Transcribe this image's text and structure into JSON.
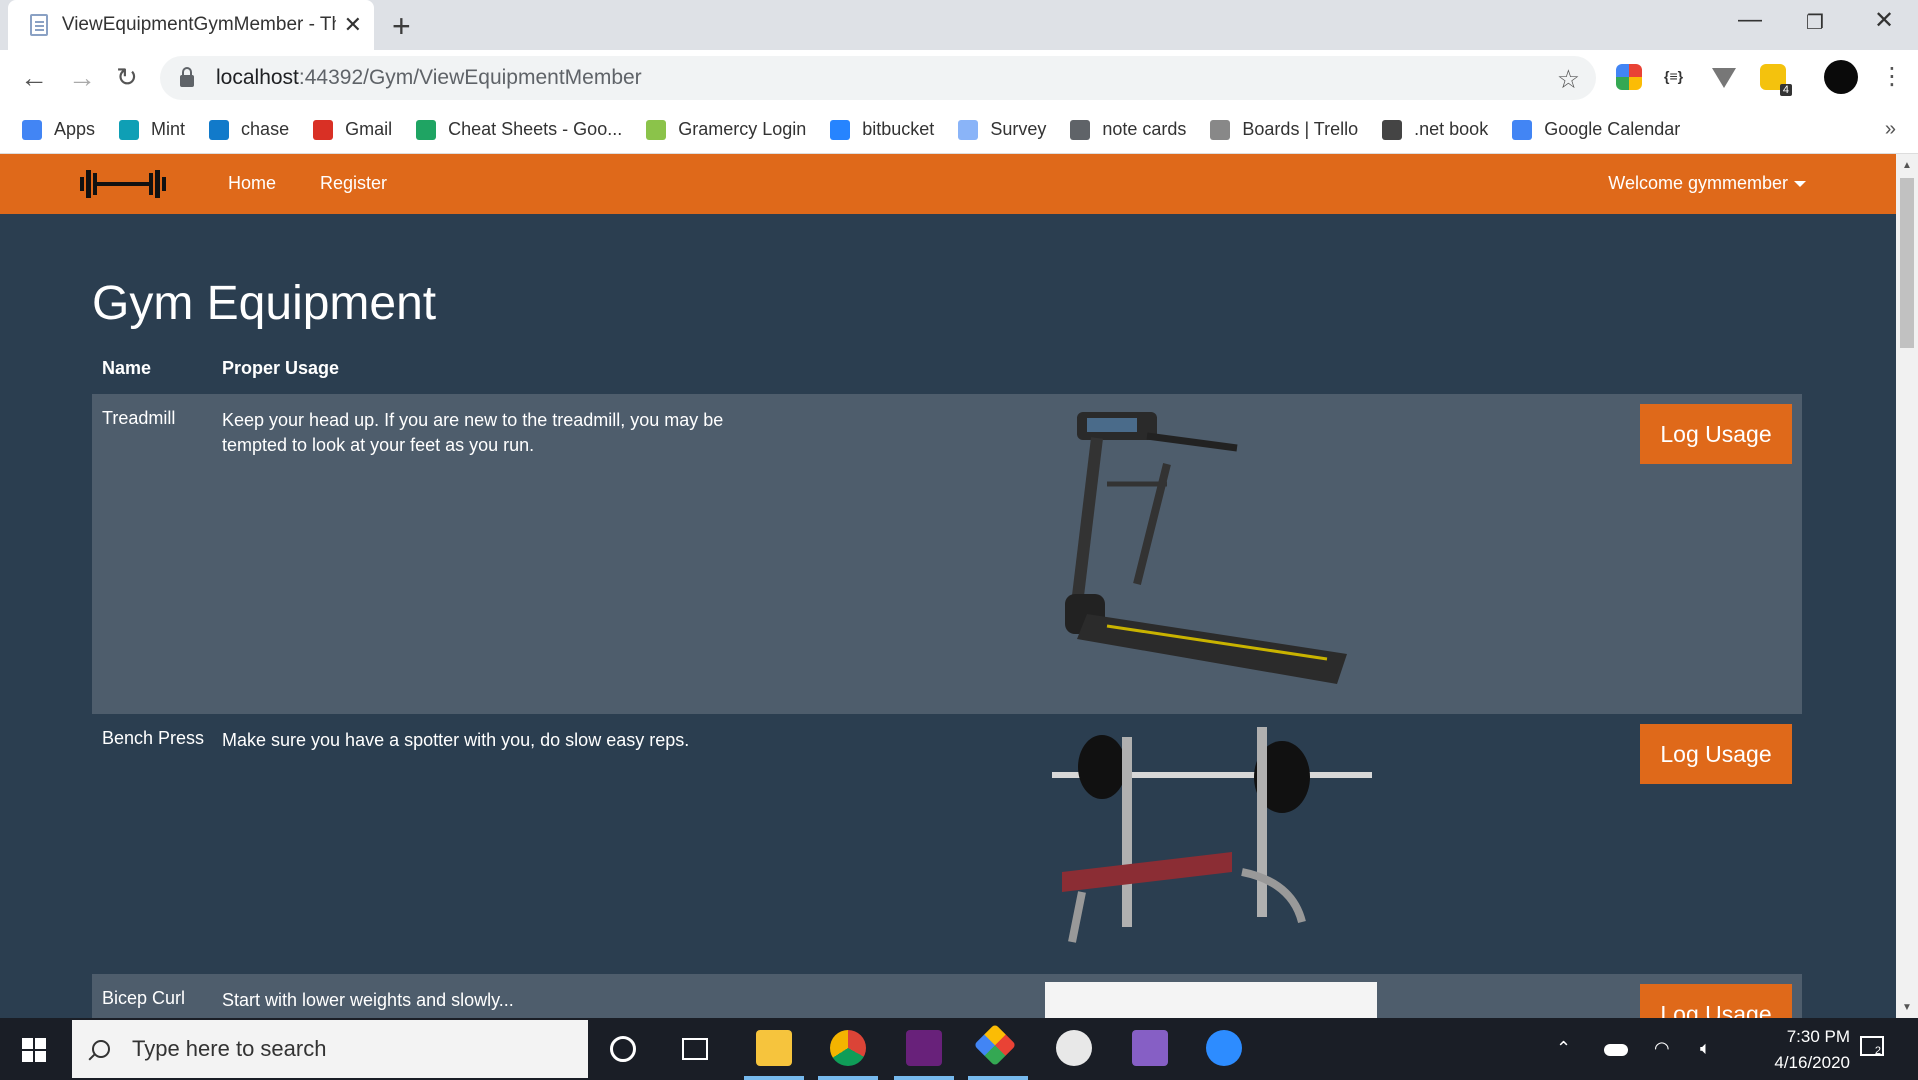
{
  "browser": {
    "tab_title": "ViewEquipmentGymMember - Th",
    "url_host": "localhost",
    "url_path": ":44392/Gym/ViewEquipmentMember",
    "extension_badge": "4",
    "bookmarks": [
      {
        "label": "Apps",
        "icon": "apps-grid-icon",
        "color": "#4285f4"
      },
      {
        "label": "Mint",
        "icon": "mint-icon",
        "color": "#0f9fb5"
      },
      {
        "label": "chase",
        "icon": "chase-icon",
        "color": "#117aca"
      },
      {
        "label": "Gmail",
        "icon": "gmail-icon",
        "color": "#d93025"
      },
      {
        "label": "Cheat Sheets - Goo...",
        "icon": "drive-icon",
        "color": "#1fa463"
      },
      {
        "label": "Gramercy Login",
        "icon": "building-icon",
        "color": "#8bc34a"
      },
      {
        "label": "bitbucket",
        "icon": "bitbucket-icon",
        "color": "#2684ff"
      },
      {
        "label": "Survey",
        "icon": "survey-icon",
        "color": "#8ab4f8"
      },
      {
        "label": "note cards",
        "icon": "globe-icon",
        "color": "#5f6368"
      },
      {
        "label": "Boards | Trello",
        "icon": "trello-icon",
        "color": "#888888"
      },
      {
        "label": ".net book",
        "icon": "book-icon",
        "color": "#444444"
      },
      {
        "label": "Google Calendar",
        "icon": "calendar-icon",
        "color": "#4285f4"
      }
    ]
  },
  "navbar": {
    "home": "Home",
    "register": "Register",
    "welcome": "Welcome gymmember"
  },
  "page": {
    "title": "Gym Equipment",
    "columns": {
      "name": "Name",
      "usage": "Proper Usage"
    },
    "button_label": "Log Usage",
    "rows": [
      {
        "name": "Treadmill",
        "usage": "Keep your head up. If you are new to the treadmill, you may be tempted to look at your feet as you run.",
        "image": "treadmill"
      },
      {
        "name": "Bench Press",
        "usage": "Make sure you have a spotter with you, do slow easy reps.",
        "image": "bench-press"
      },
      {
        "name": "Bicep Curl",
        "usage": "Start with lower weights and slowly...",
        "image": "curl-machine"
      }
    ]
  },
  "taskbar": {
    "search_placeholder": "Type here to search",
    "time": "7:30 PM",
    "date": "4/16/2020",
    "notifications": "2"
  },
  "colors": {
    "accent": "#df691a",
    "page_bg": "#2b3e50",
    "row_alt": "#4e5d6c"
  }
}
